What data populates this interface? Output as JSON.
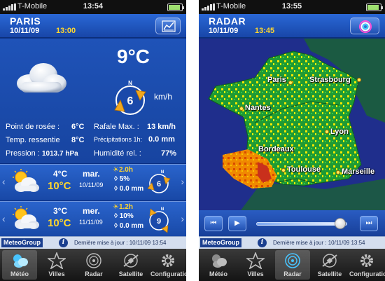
{
  "status": {
    "carrier": "T-Mobile",
    "left_time": "13:54",
    "right_time": "13:55"
  },
  "left": {
    "header": {
      "title": "PARIS",
      "date": "10/11/09",
      "time": "13:00"
    },
    "current": {
      "temp": "9°C",
      "wind_dir": "N",
      "wind_speed": "6",
      "wind_unit": "km/h",
      "details": [
        {
          "label": "Point de rosée :",
          "value": "6°C"
        },
        {
          "label": "Rafale Max. :",
          "value": "13 km/h"
        },
        {
          "label": "Temp. ressentie",
          "value": "8°C"
        },
        {
          "label": "Précipitations 1h:",
          "value": "0.0 mm"
        },
        {
          "label": "Pression :",
          "value": "1013.7 hPa"
        },
        {
          "label": "Humidité rel. :",
          "value": "77%"
        }
      ]
    },
    "forecast": [
      {
        "lo": "4°C",
        "hi": "10°C",
        "day": "mar.",
        "date": "10/11/09",
        "sun": "2.0h",
        "precip": "5%",
        "mm": "0.0 mm",
        "wind_dir": "N",
        "wind_speed": "6"
      },
      {
        "lo": "3°C",
        "hi": "10°C",
        "day": "mer.",
        "date": "11/11/09",
        "sun": "1.2h",
        "precip": "10%",
        "mm": "0.0 mm",
        "wind_dir": "N",
        "wind_speed": "9"
      }
    ],
    "footer": {
      "brand": "MeteoGroup",
      "info": "i",
      "update": "Dernière mise à jour : 10/11/09 13:54"
    }
  },
  "right": {
    "header": {
      "title": "RADAR",
      "date": "10/11/09",
      "time": "13:45"
    },
    "cities": [
      "Paris",
      "Strasbourg",
      "Nantes",
      "Lyon",
      "Bordeaux",
      "Toulouse",
      "Marseille"
    ],
    "player": {
      "rewind": "⏮",
      "play": "▶",
      "forward": "⏭",
      "progress": 0.92
    },
    "footer": {
      "brand": "MeteoGroup",
      "info": "i",
      "update": "Dernière mise à jour : 10/11/09 13:54"
    }
  },
  "tabs": [
    {
      "label": "Météo",
      "icon": "weather-icon"
    },
    {
      "label": "Villes",
      "icon": "star-icon"
    },
    {
      "label": "Radar",
      "icon": "radar-icon"
    },
    {
      "label": "Satellite",
      "icon": "satellite-icon"
    },
    {
      "label": "Configuration",
      "icon": "gear-icon"
    }
  ],
  "colors": {
    "accent_yellow": "#ffd62e",
    "header_blue": "#1846a8",
    "panel_blue": "#1744a0",
    "wind_arrow": "#f2a81d",
    "map_blue": "#1f2e8c"
  }
}
